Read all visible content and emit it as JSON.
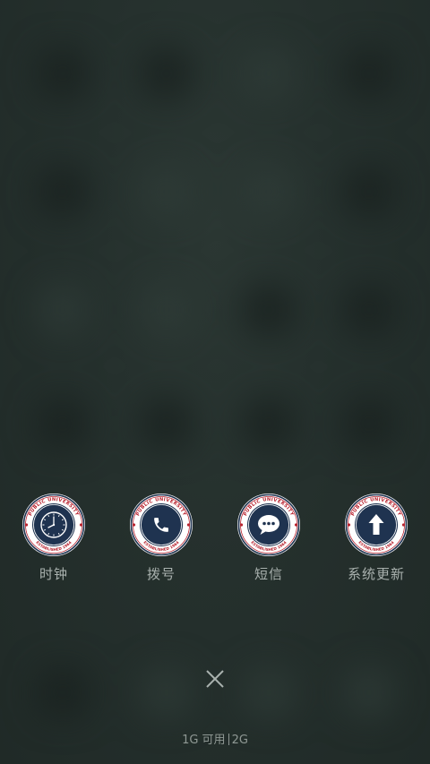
{
  "shortcuts": [
    {
      "label": "时钟",
      "icon": "clock-icon",
      "badge_ring_text": "PUBLIC UNIVERSITY",
      "badge_bottom_text": "ESTABLISHED 1964"
    },
    {
      "label": "拨号",
      "icon": "phone-icon",
      "badge_ring_text": "PUBLIC UNIVERSITY",
      "badge_bottom_text": "ESTABLISHED 1964"
    },
    {
      "label": "短信",
      "icon": "message-icon",
      "badge_ring_text": "PUBLIC UNIVERSITY",
      "badge_bottom_text": "ESTABLISHED 1964"
    },
    {
      "label": "系统更新",
      "icon": "arrow-up-icon",
      "badge_ring_text": "PUBLIC UNIVERSITY",
      "badge_bottom_text": "ESTABLISHED 1964"
    }
  ],
  "close": {
    "icon": "close-icon"
  },
  "memory": {
    "available": "1G 可用",
    "total": "2G"
  },
  "colors": {
    "background": "#253028",
    "badge_navy": "#1f3350",
    "badge_red": "#b8232f",
    "label_text": "#a9b1ae"
  }
}
